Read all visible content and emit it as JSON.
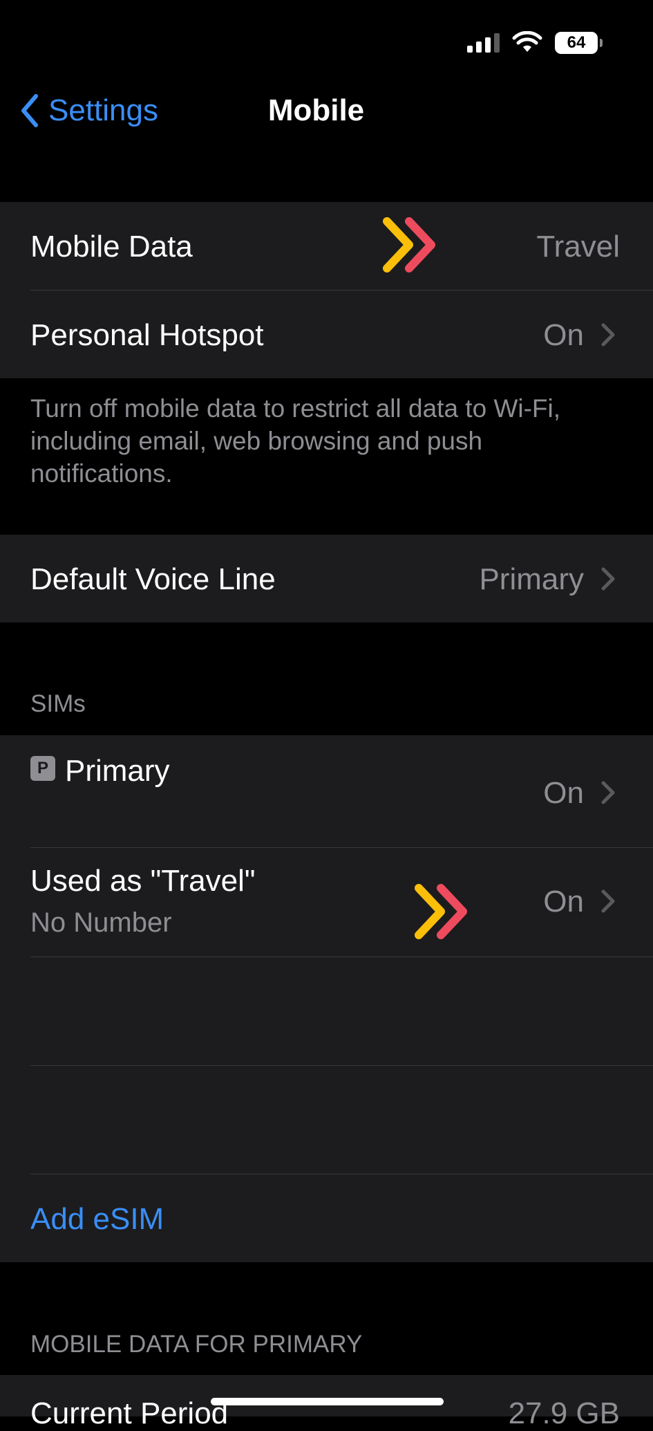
{
  "status_bar": {
    "battery_level": "64",
    "signal_bars": 3,
    "signal_bars_total": 4,
    "wifi": true
  },
  "nav": {
    "back_label": "Settings",
    "title": "Mobile"
  },
  "group_data": {
    "mobile_data": {
      "label": "Mobile Data",
      "value": "Travel"
    },
    "personal_hotspot": {
      "label": "Personal Hotspot",
      "value": "On"
    },
    "footer": "Turn off mobile data to restrict all data to Wi-Fi, including email, web browsing and push notifications."
  },
  "group_voice": {
    "default_voice_line": {
      "label": "Default Voice Line",
      "value": "Primary"
    }
  },
  "sims": {
    "header": "SIMs",
    "badge": "P",
    "primary": {
      "label": "Primary",
      "value": "On"
    },
    "travel": {
      "label": "Used as \"Travel\"",
      "sublabel": "No Number",
      "value": "On"
    },
    "add_esim": "Add eSIM"
  },
  "mobile_data_section": {
    "header": "MOBILE DATA FOR PRIMARY",
    "current_period": {
      "label": "Current Period",
      "value": "27.9 GB"
    }
  },
  "colors": {
    "accent": "#3a8ef6",
    "arrow_yellow": "#fbbf0a",
    "arrow_red": "#ee4c5e",
    "cell_bg": "#1c1c1e"
  }
}
